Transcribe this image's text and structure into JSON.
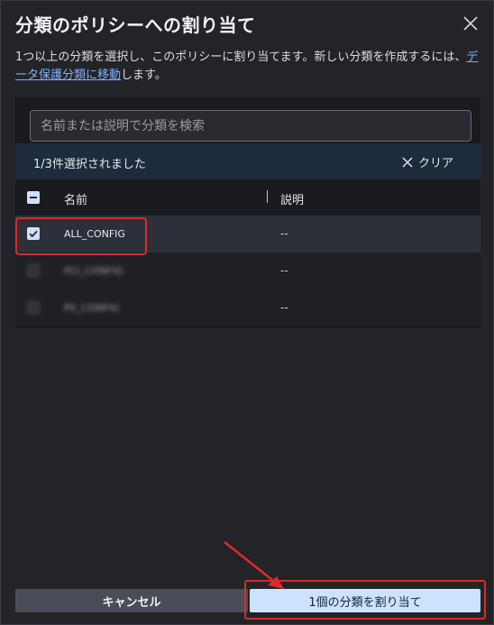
{
  "dialog": {
    "title": "分類のポリシーへの割り当て",
    "description_prefix": "1つ以上の分類を選択し、このポリシーに割り当てます。新しい分類を作成するには、",
    "description_link": "データ保護分類に移動",
    "description_suffix": "します。"
  },
  "search": {
    "placeholder": "名前または説明で分類を検索",
    "value": ""
  },
  "selection": {
    "count_text": "1/3件選択されました",
    "clear_label": "クリア"
  },
  "table": {
    "columns": [
      "名前",
      "説明"
    ],
    "rows": [
      {
        "name": "ALL_CONFIG",
        "description": "--",
        "checked": true
      },
      {
        "name": "PCI_CONFIG",
        "description": "--",
        "checked": false
      },
      {
        "name": "PII_CONFIG",
        "description": "--",
        "checked": false
      }
    ]
  },
  "footer": {
    "cancel_label": "キャンセル",
    "assign_label": "1個の分類を割り当て"
  },
  "colors": {
    "accent": "#3b82f6",
    "highlight": "#d42d2d",
    "primary_button": "#cce3ff"
  }
}
